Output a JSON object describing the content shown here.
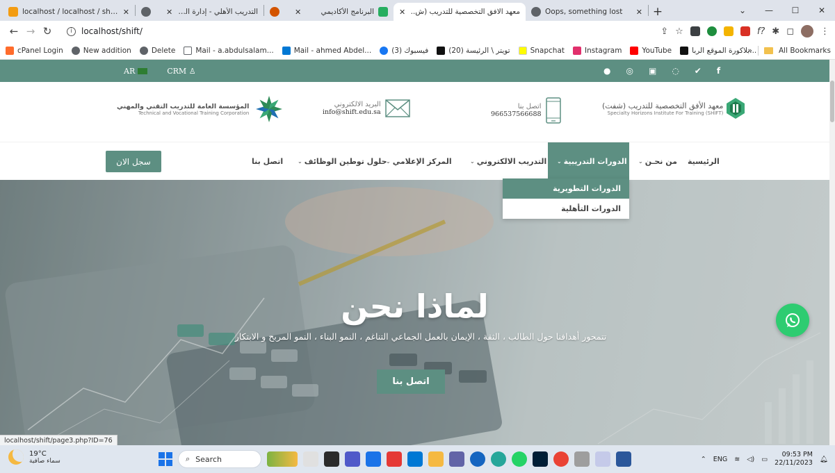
{
  "browser": {
    "tabs": [
      {
        "title": "localhost / localhost / shift / web",
        "favicon_color": "#f39c12",
        "active": false
      },
      {
        "title": "",
        "favicon_color": "#5f6368",
        "active": false
      },
      {
        "title": "التدريب الأهلي - إدارة الرخص",
        "favicon_color": "#d35400",
        "active": false
      },
      {
        "title": "البرنامج الأكاديمي",
        "favicon_color": "#27ae60",
        "active": false
      },
      {
        "title": "معهد الافق التخصصية للتدريب (ش..",
        "favicon_color": "#5d8f82",
        "active": true
      },
      {
        "title": "Oops, something lost",
        "favicon_color": "#5f6368",
        "active": false
      }
    ],
    "url": "localhost/shift/",
    "bookmarks": [
      {
        "label": "cPanel Login",
        "color": "#ff6c2c"
      },
      {
        "label": "New addition",
        "color": "#5f6368"
      },
      {
        "label": "Delete",
        "color": "#5f6368"
      },
      {
        "label": "Mail - a.abdulsalam...",
        "color": "#5f6368"
      },
      {
        "label": "Mail - ahmed Abdel...",
        "color": "#0078d4"
      },
      {
        "label": "(3) فيسبوك",
        "color": "#1877f2"
      },
      {
        "label": "(20) تويتر \\ الرئيسة",
        "color": "#111111"
      },
      {
        "label": "Snapchat",
        "color": "#fffc00"
      },
      {
        "label": "Instagram",
        "color": "#e1306c"
      },
      {
        "label": "YouTube",
        "color": "#ff0000"
      },
      {
        "label": "بلاكورة الموقع الربا...",
        "color": "#111111"
      }
    ],
    "bookmarks_more": "»",
    "all_bookmarks": "All Bookmarks",
    "status_url": "localhost/shift/page3.php?ID=76"
  },
  "site": {
    "topbar": {
      "lang": "AR",
      "crm": "CRM"
    },
    "info": {
      "corp_ar": "المؤسسة العامة للتدريب التقني والمهني",
      "corp_en": "Technical and Vocational Training Corporation",
      "email_label": "البريد الالكتروني",
      "email_value": "info@shift.edu.sa",
      "phone_label": "اتصل بنا",
      "phone_value": "966537566688",
      "logo_ar": "معهد الأفق التخصصية للتدريب (شفت)",
      "logo_en": "Specialty Horizons Institute For Training (SHIFT)"
    },
    "nav": {
      "home": "الرئيسية",
      "about": "من نحـن",
      "courses": "الدورات التدريبية",
      "elearning": "التدريب الالكتروني",
      "media": "المركز الإعلامي",
      "jobs": "حلول توطين الوظائف",
      "contact": "اتصل بنا",
      "register": "سجل الان"
    },
    "dropdown": {
      "item1": "الدورات التطويرية",
      "item2": "الدورات التأهلية"
    },
    "hero": {
      "title": "لماذا نحن",
      "subtitle": "تتمحور أهدافنا حول الطالب ، الثقة ، الإيمان بالعمل الجماعي التناغم ، النمو البناء ، النمو المربح و الابتكار",
      "button": "اتصل بنا"
    }
  },
  "taskbar": {
    "temp": "19°C",
    "weather": "سماء صافية",
    "search": "Search",
    "lang": "ENG",
    "time": "09:53 PM",
    "date": "22/11/2023"
  }
}
